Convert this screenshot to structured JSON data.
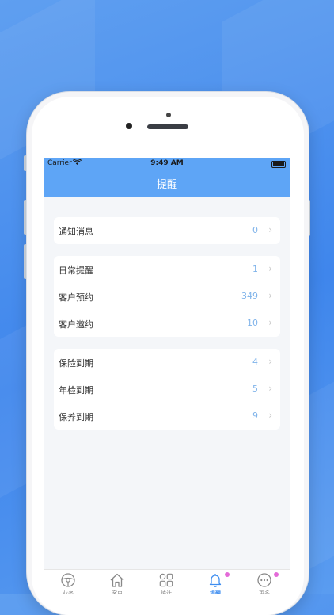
{
  "status_bar": {
    "carrier": "Carrier",
    "time": "9:49 AM"
  },
  "nav": {
    "title": "提醒"
  },
  "groups": [
    {
      "rows": [
        {
          "label": "通知消息",
          "value": "0"
        }
      ]
    },
    {
      "rows": [
        {
          "label": "日常提醒",
          "value": "1"
        },
        {
          "label": "客户预约",
          "value": "349"
        },
        {
          "label": "客户邀约",
          "value": "10"
        }
      ]
    },
    {
      "rows": [
        {
          "label": "保险到期",
          "value": "4"
        },
        {
          "label": "年检到期",
          "value": "5"
        },
        {
          "label": "保养到期",
          "value": "9"
        }
      ]
    }
  ],
  "tabbar": {
    "tabs": [
      {
        "label": "业务",
        "icon": "steering-wheel-icon",
        "active": false,
        "badge": false
      },
      {
        "label": "客户",
        "icon": "home-icon",
        "active": false,
        "badge": false
      },
      {
        "label": "统计",
        "icon": "grid-icon",
        "active": false,
        "badge": false
      },
      {
        "label": "提醒",
        "icon": "bell-icon",
        "active": true,
        "badge": true
      },
      {
        "label": "更多",
        "icon": "more-icon",
        "active": false,
        "badge": true
      }
    ],
    "active_color": "#3f8ef0",
    "badge_color": "#e46ad8"
  }
}
